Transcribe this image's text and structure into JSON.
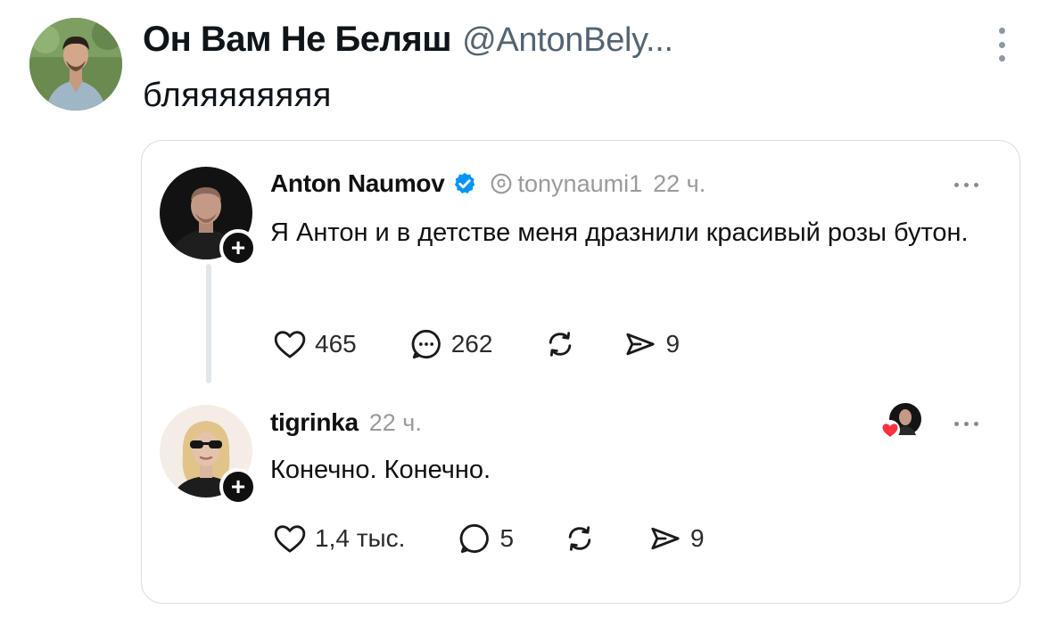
{
  "tweet": {
    "author_name": "Он Вам Не Беляш",
    "author_handle": "@AntonBely...",
    "text": "бляяяяяяяя"
  },
  "quoted_thread": {
    "post": {
      "author": "Anton Naumov",
      "verified": true,
      "handle": "tonynaumi1",
      "time": "22 ч.",
      "text": "Я Антон и в детстве меня дразнили красивый розы бутон.",
      "likes": "465",
      "replies": "262",
      "shares": "9"
    },
    "reply": {
      "author": "tigrinka",
      "time": "22 ч.",
      "text": "Конечно. Конечно.",
      "likes": "1,4 тыс.",
      "replies": "5",
      "shares": "9"
    },
    "plus_label": "+"
  },
  "colors": {
    "text_primary": "#0f1419",
    "text_secondary": "#536471",
    "verified_blue": "#0095f6",
    "heart_red": "#ff3040",
    "card_border": "#d6dde3"
  }
}
